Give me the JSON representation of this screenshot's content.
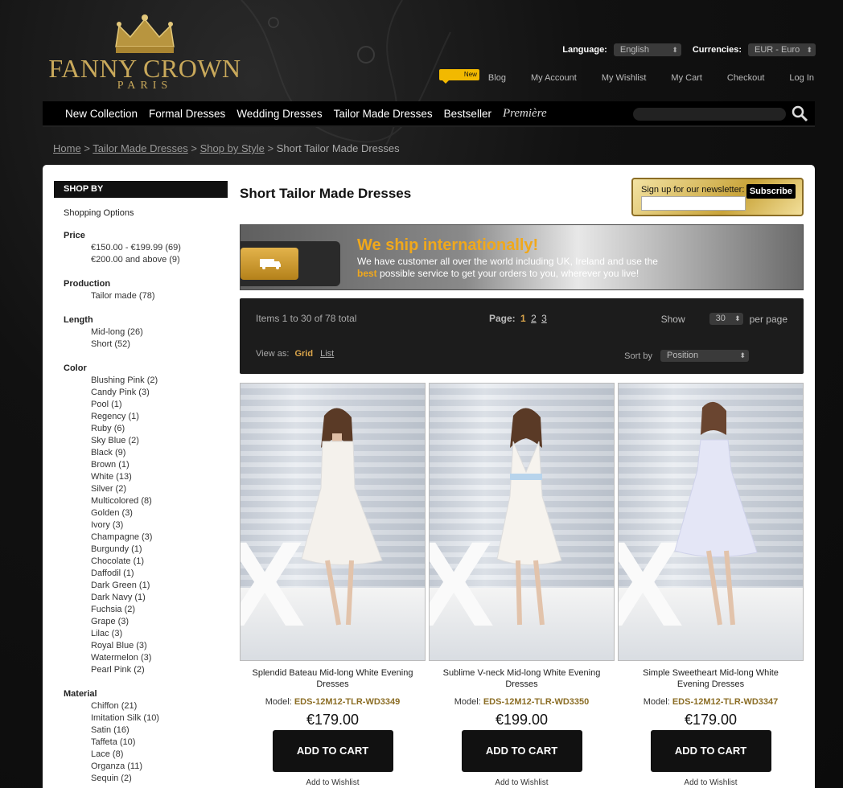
{
  "brand": {
    "name": "FANNY CROWN",
    "city": "PARIS"
  },
  "header": {
    "language_label": "Language:",
    "language_value": "English",
    "currency_label": "Currencies:",
    "currency_value": "EUR - Euro",
    "new_badge": "New",
    "links": [
      "Blog",
      "My Account",
      "My Wishlist",
      "My Cart",
      "Checkout",
      "Log In"
    ]
  },
  "nav": {
    "items": [
      "New Collection",
      "Formal Dresses",
      "Wedding Dresses",
      "Tailor Made Dresses",
      "Bestseller"
    ],
    "premiere": "Première"
  },
  "breadcrumb": {
    "links": [
      "Home",
      "Tailor Made Dresses",
      "Shop by Style"
    ],
    "separator": ">",
    "current": "Short Tailor Made Dresses"
  },
  "sidebar": {
    "title": "SHOP BY",
    "subtitle": "Shopping Options",
    "groups": [
      {
        "title": "Price",
        "options": [
          "€150.00 - €199.99 (69)",
          "€200.00 and above (9)"
        ]
      },
      {
        "title": "Production",
        "options": [
          "Tailor made (78)"
        ]
      },
      {
        "title": "Length",
        "options": [
          "Mid-long (26)",
          "Short (52)"
        ]
      },
      {
        "title": "Color",
        "options": [
          "Blushing Pink (2)",
          "Candy Pink (3)",
          "Pool (1)",
          "Regency (1)",
          "Ruby (6)",
          "Sky Blue (2)",
          "Black (9)",
          "Brown (1)",
          "White (13)",
          "Silver (2)",
          "Multicolored (8)",
          "Golden (3)",
          "Ivory (3)",
          "Champagne (3)",
          "Burgundy (1)",
          "Chocolate (1)",
          "Daffodil (1)",
          "Dark Green (1)",
          "Dark Navy (1)",
          "Fuchsia (2)",
          "Grape (3)",
          "Lilac (3)",
          "Royal Blue (3)",
          "Watermelon (3)",
          "Pearl Pink (2)"
        ]
      },
      {
        "title": "Material",
        "options": [
          "Chiffon (21)",
          "Imitation Silk (10)",
          "Satin (16)",
          "Taffeta (10)",
          "Lace (8)",
          "Organza (11)",
          "Sequin (2)"
        ]
      }
    ]
  },
  "main": {
    "title": "Short Tailor Made Dresses",
    "newsletter": {
      "label": "Sign up for our newsletter:",
      "button": "Subscribe",
      "placeholder": ""
    },
    "banner": {
      "heading": "We ship internationally!",
      "line1": "We have customer all over the world including UK, Ireland and use the",
      "line2_bold": "best",
      "line2": " possible service to get your orders to you, wherever you live!"
    },
    "toolbar": {
      "items_text": "Items 1 to 30 of 78 total",
      "page_label": "Page:",
      "pages": [
        "1",
        "2",
        "3"
      ],
      "show_label": "Show",
      "per_page_value": "30",
      "per_page_label": "per page",
      "view_label": "View as:",
      "view_grid": "Grid",
      "view_list": "List",
      "sort_label": "Sort by",
      "sort_value": "Position"
    },
    "products": [
      {
        "name": "Splendid Bateau Mid-long White Evening Dresses",
        "model_label": "Model:",
        "model": "EDS-12M12-TLR-WD3349",
        "price": "€179.00",
        "cart": "ADD TO CART",
        "wishlist": "Add to Wishlist",
        "dress_color": "#f4f1ec"
      },
      {
        "name": "Sublime V-neck Mid-long White Evening Dresses",
        "model_label": "Model:",
        "model": "EDS-12M12-TLR-WD3350",
        "price": "€199.00",
        "cart": "ADD TO CART",
        "wishlist": "Add to Wishlist",
        "dress_color": "#f6f3ee"
      },
      {
        "name": "Simple Sweetheart Mid-long White Evening Dresses",
        "model_label": "Model:",
        "model": "EDS-12M12-TLR-WD3347",
        "price": "€179.00",
        "cart": "ADD TO CART",
        "wishlist": "Add to Wishlist",
        "dress_color": "#e4e6f6"
      }
    ]
  },
  "colors": {
    "gold": "#c9a95b",
    "accent": "#d9a44a",
    "banner_orange": "#f0a81c",
    "model_gold": "#8b6d25"
  }
}
